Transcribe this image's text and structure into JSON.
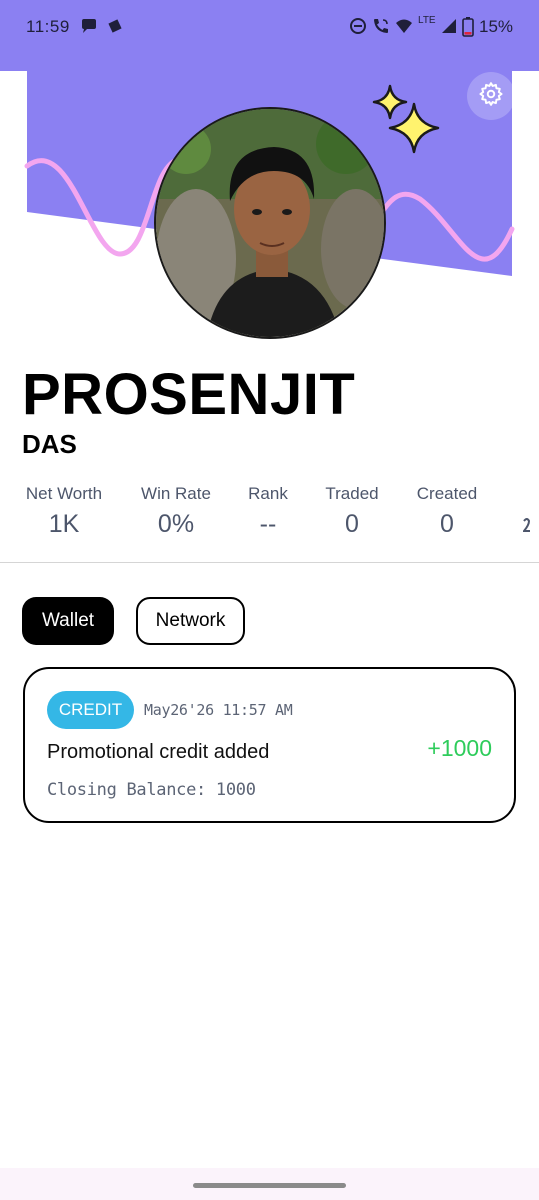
{
  "status_bar": {
    "time": "11:59",
    "battery": "15%",
    "network_label": "LTE",
    "icons": [
      "chat-bubble-icon",
      "diamond-icon",
      "dnd-icon",
      "wifi-call-icon",
      "wifi-icon",
      "signal-icon",
      "battery-icon"
    ],
    "battery_level": 0.15
  },
  "header": {
    "banner_color": "#8b80f2",
    "wave_color": "#f3a6ef",
    "sparkle_color": "#fff36e",
    "settings_icon": "gear-icon"
  },
  "profile": {
    "first_name": "PROSENJIT",
    "last_name": "DAS"
  },
  "stats": [
    {
      "label": "Net Worth",
      "value": "1K"
    },
    {
      "label": "Win Rate",
      "value": "0%"
    },
    {
      "label": "Rank",
      "value": "--"
    },
    {
      "label": "Traded",
      "value": "0"
    },
    {
      "label": "Created",
      "value": "0"
    }
  ],
  "tabs": [
    {
      "label": "Wallet",
      "active": true
    },
    {
      "label": "Network",
      "active": false
    }
  ],
  "transactions": [
    {
      "type": "CREDIT",
      "date": "May26'26 11:57 AM",
      "title": "Promotional credit added",
      "amount": "+1000",
      "closing_balance": "Closing Balance: 1000",
      "badge_color": "#34b7e6",
      "amount_color": "#2ecc5b"
    }
  ]
}
